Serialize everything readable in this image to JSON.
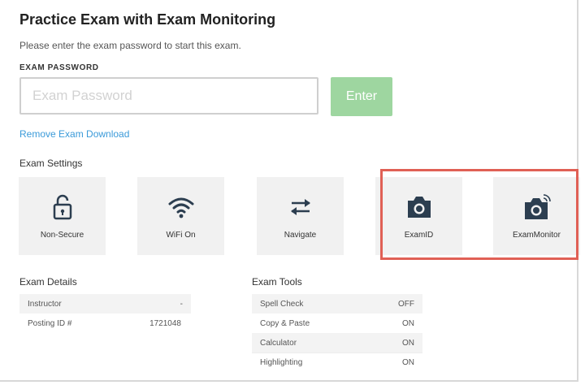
{
  "header": {
    "title": "Practice Exam with Exam Monitoring",
    "subtitle": "Please enter the exam password to start this exam."
  },
  "password": {
    "label": "EXAM PASSWORD",
    "placeholder": "Exam Password",
    "value": "",
    "enter_label": "Enter"
  },
  "remove_link": "Remove Exam Download",
  "settings": {
    "heading": "Exam Settings",
    "tiles": [
      {
        "label": "Non-Secure",
        "icon": "unlock-icon"
      },
      {
        "label": "WiFi On",
        "icon": "wifi-icon"
      },
      {
        "label": "Navigate",
        "icon": "swap-arrows-icon"
      },
      {
        "label": "ExamID",
        "icon": "camera-icon"
      },
      {
        "label": "ExamMonitor",
        "icon": "camera-monitor-icon"
      }
    ],
    "highlight_color": "#e06055"
  },
  "details": {
    "heading": "Exam Details",
    "rows": [
      {
        "key": "Instructor",
        "value": "-"
      },
      {
        "key": "Posting ID #",
        "value": "1721048"
      }
    ]
  },
  "tools": {
    "heading": "Exam Tools",
    "rows": [
      {
        "key": "Spell Check",
        "value": "OFF"
      },
      {
        "key": "Copy & Paste",
        "value": "ON"
      },
      {
        "key": "Calculator",
        "value": "ON"
      },
      {
        "key": "Highlighting",
        "value": "ON"
      }
    ]
  },
  "colors": {
    "enter_button": "#9ed6a0",
    "link": "#3a9ad9",
    "tile_bg": "#f1f1f1",
    "icon": "#2c3e50"
  }
}
